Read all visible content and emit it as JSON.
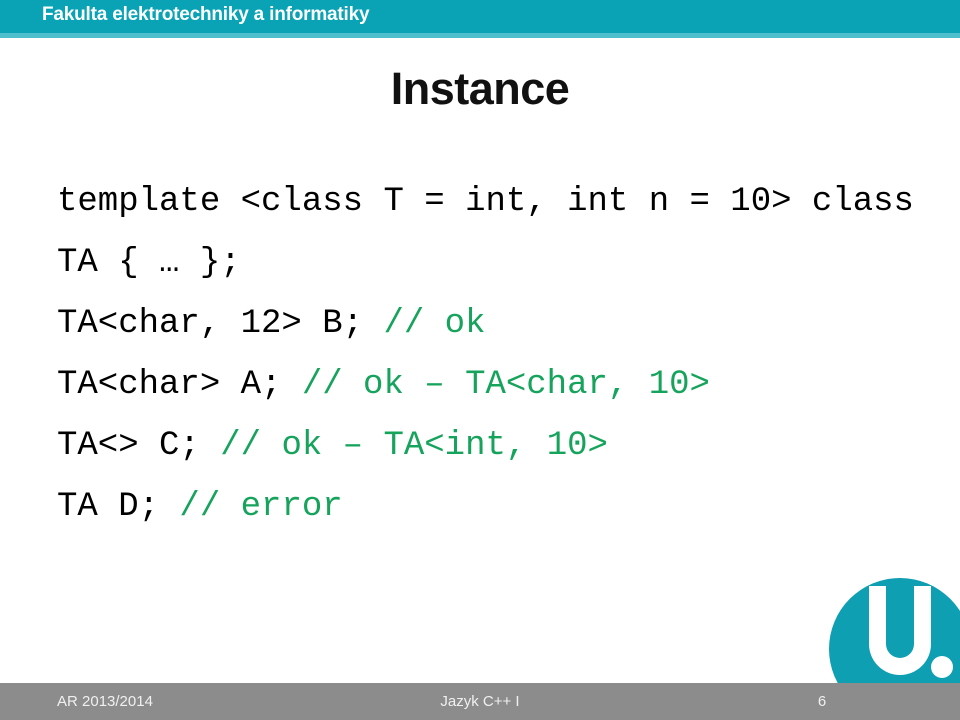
{
  "header": {
    "faculty_title": "Fakulta elektrotechniky a informatiky",
    "bar_color": "#0aa3b5",
    "underbar_color": "#4dbfcd"
  },
  "slide": {
    "title": "Instance",
    "title_color": "#111111"
  },
  "code": {
    "comment_color": "#16a35c",
    "code_color": "#000000",
    "lines": [
      {
        "id": "line-1",
        "segments": [
          {
            "kind": "code",
            "text": "template <class T = int, int n = 10> class TA { … };"
          }
        ]
      },
      {
        "id": "line-2",
        "segments": [
          {
            "kind": "code",
            "text": "TA<char, 12> B; "
          },
          {
            "kind": "comment",
            "text": "// ok"
          }
        ]
      },
      {
        "id": "line-3",
        "segments": [
          {
            "kind": "code",
            "text": "TA<char> A; "
          },
          {
            "kind": "comment",
            "text": "// ok – TA<char, 10>"
          }
        ]
      },
      {
        "id": "line-4",
        "segments": [
          {
            "kind": "code",
            "text": "TA<> C; "
          },
          {
            "kind": "comment",
            "text": "// ok – TA<int, 10>"
          }
        ]
      },
      {
        "id": "line-5",
        "segments": [
          {
            "kind": "code",
            "text": "TA D; "
          },
          {
            "kind": "comment",
            "text": "// error"
          }
        ]
      }
    ]
  },
  "logo": {
    "name": "vsb-tuo-u-logo",
    "circle_color": "#0f9fb3",
    "letter_color": "#ffffff",
    "dot_large_color": "#ffffff",
    "dot_small_color": "#9a9a9a"
  },
  "footer": {
    "left": "AR 2013/2014",
    "center": "Jazyk C++ I",
    "page_number": "6",
    "bar_color": "#8c8c8c",
    "text_color": "#f0f0f0"
  }
}
